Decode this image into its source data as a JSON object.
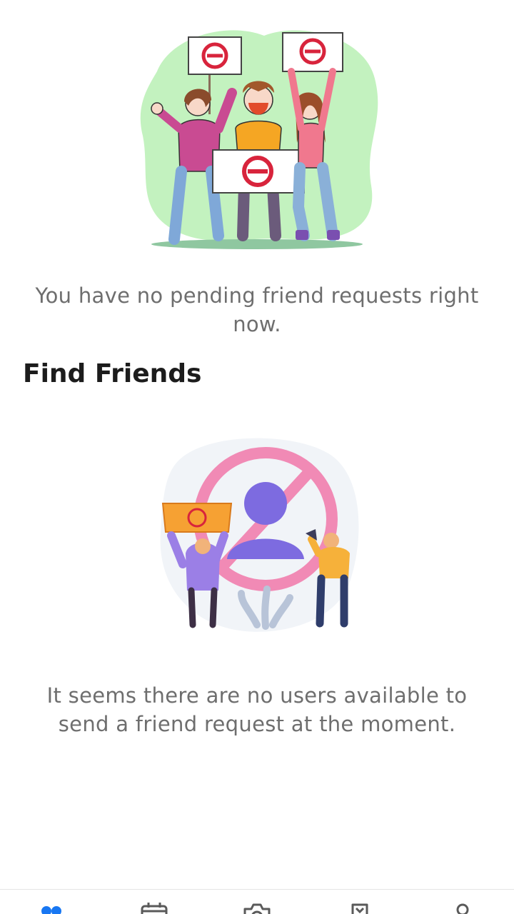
{
  "pending": {
    "empty_message": "You have no pending friend requests right now."
  },
  "find_friends": {
    "title": "Find Friends",
    "empty_message": "It seems there are no users available to send a friend request at the moment."
  },
  "bottom_nav": {
    "active_color": "#1877F2",
    "inactive_color": "#5a5a5a",
    "items": [
      {
        "icon": "friends-icon",
        "active": true
      },
      {
        "icon": "calendar-icon",
        "active": false
      },
      {
        "icon": "camera-icon",
        "active": false
      },
      {
        "icon": "bookmark-icon",
        "active": false
      },
      {
        "icon": "profile-icon",
        "active": false
      }
    ]
  }
}
